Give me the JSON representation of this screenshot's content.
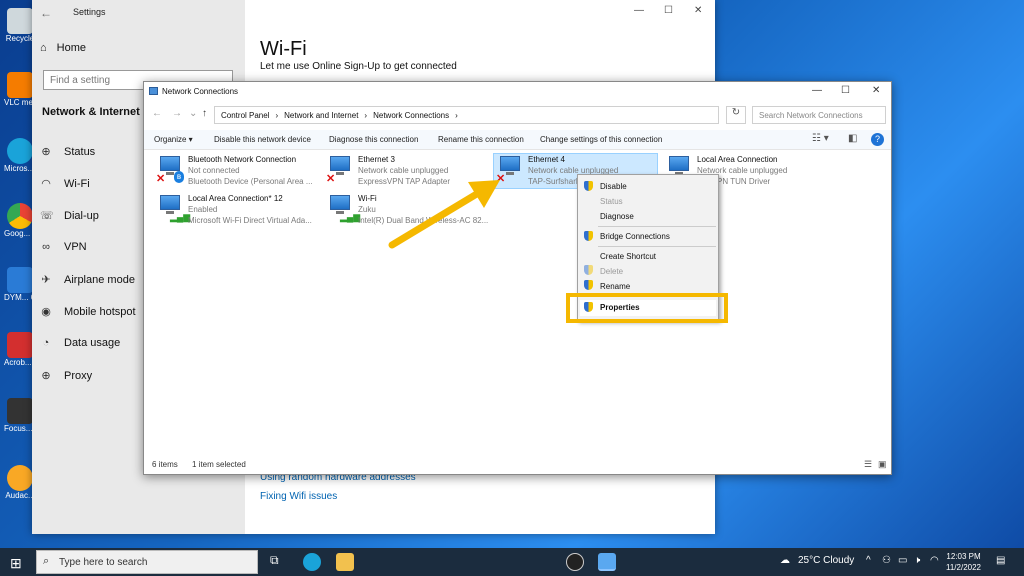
{
  "desktop_icons": [
    {
      "label": "Recycle",
      "color": "#cfd8dc"
    },
    {
      "label": "VLC me... player",
      "color": "#f57c00"
    },
    {
      "label": "Micros... Edge",
      "color": "#1aa3d9"
    },
    {
      "label": "Goog... Chrom",
      "color": "#ea4335"
    },
    {
      "label": "DYM... Conn",
      "color": "#2a7bd6"
    },
    {
      "label": "Acrob... Reader",
      "color": "#d32f2f"
    },
    {
      "label": "Focus... Conn",
      "color": "#333333"
    },
    {
      "label": "Audac...",
      "color": "#f9a825"
    }
  ],
  "settings": {
    "title": "Settings",
    "home": "Home",
    "find_placeholder": "Find a setting",
    "section": "Network & Internet",
    "nav": [
      {
        "icon": "globe-icon",
        "glyph": "⊕",
        "label": "Status"
      },
      {
        "icon": "wifi-icon",
        "glyph": "◠",
        "label": "Wi-Fi"
      },
      {
        "icon": "dialup-icon",
        "glyph": "☏",
        "label": "Dial-up"
      },
      {
        "icon": "vpn-icon",
        "glyph": "∞",
        "label": "VPN"
      },
      {
        "icon": "airplane-icon",
        "glyph": "✈",
        "label": "Airplane mode"
      },
      {
        "icon": "hotspot-icon",
        "glyph": "◉",
        "label": "Mobile hotspot"
      },
      {
        "icon": "data-usage-icon",
        "glyph": "◔",
        "label": "Data usage"
      },
      {
        "icon": "proxy-icon",
        "glyph": "⊕",
        "label": "Proxy"
      }
    ],
    "page_title": "Wi-Fi",
    "sub": "Let me use Online Sign-Up to get connected",
    "link1": "Using random hardware addresses",
    "link2": "Fixing Wifi issues"
  },
  "netwin": {
    "title": "Network Connections",
    "breadcrumb": [
      "Control Panel",
      "Network and Internet",
      "Network Connections"
    ],
    "search_placeholder": "Search Network Connections",
    "commands": [
      "Organize ▾",
      "Disable this network device",
      "Diagnose this connection",
      "Rename this connection",
      "Change settings of this connection"
    ],
    "connections": [
      {
        "name": "Bluetooth Network Connection",
        "status": "Not connected",
        "device": "Bluetooth Device (Personal Area ..."
      },
      {
        "name": "Ethernet 3",
        "status": "Network cable unplugged",
        "device": "ExpressVPN TAP Adapter"
      },
      {
        "name": "Ethernet 4",
        "status": "Network cable unplugged",
        "device": "TAP-Surfshark"
      },
      {
        "name": "Local Area Connection",
        "status": "Network cable unplugged",
        "device": "...ssVPN TUN Driver"
      },
      {
        "name": "Local Area Connection* 12",
        "status": "Enabled",
        "device": "Microsoft Wi-Fi Direct Virtual Ada..."
      },
      {
        "name": "Wi-Fi",
        "status": "Zuku",
        "device": "Intel(R) Dual Band Wireless-AC 82..."
      }
    ],
    "status_items": "6 items",
    "status_selected": "1 item selected"
  },
  "context_menu": {
    "disable": "Disable",
    "status": "Status",
    "diagnose": "Diagnose",
    "bridge": "Bridge Connections",
    "shortcut": "Create Shortcut",
    "delete": "Delete",
    "rename": "Rename",
    "properties": "Properties"
  },
  "taskbar": {
    "search_placeholder": "Type here to search",
    "weather": "25°C Cloudy",
    "time": "12:03 PM",
    "date": "11/2/2022"
  },
  "colors": {
    "highlight": "#f5b800",
    "accent": "#0063b1"
  }
}
